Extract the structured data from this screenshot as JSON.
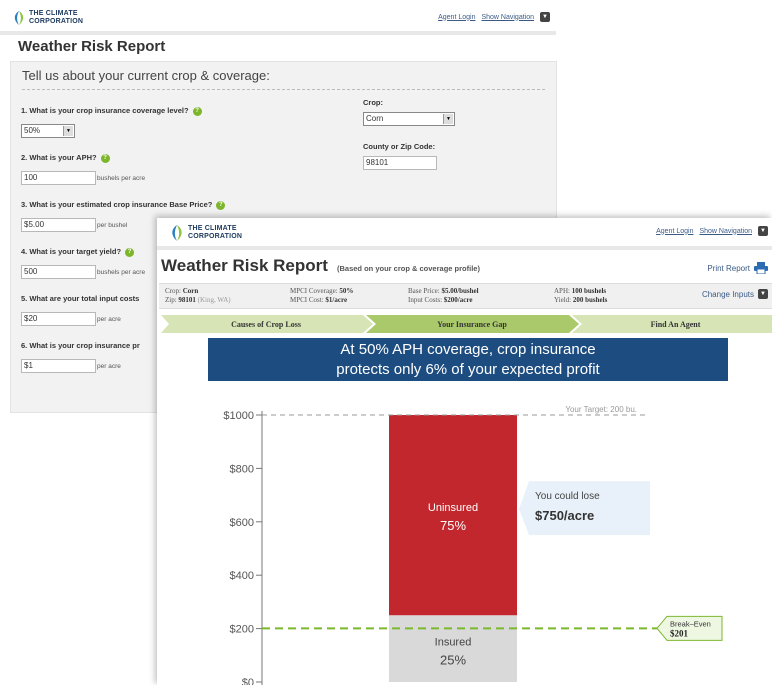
{
  "brand": {
    "line1": "THE CLIMATE",
    "line2": "CORPORATION"
  },
  "nav": {
    "agent_login": "Agent Login",
    "show_navigation": "Show Navigation"
  },
  "form": {
    "title": "Weather Risk Report",
    "panel_title": "Tell us about your current crop & coverage:",
    "questions": [
      {
        "label": "1. What is your crop insurance coverage level?",
        "value": "50%"
      },
      {
        "label": "2. What is your APH?",
        "value": "100",
        "unit": "bushels per acre"
      },
      {
        "label": "3. What is your estimated crop insurance Base Price?",
        "value": "$5.00",
        "unit": "per bushel"
      },
      {
        "label": "4. What is your target yield?",
        "value": "500",
        "unit": "bushels per acre"
      },
      {
        "label": "5. What are your total input costs",
        "value": "$20",
        "unit": "per acre"
      },
      {
        "label": "6. What is your crop insurance pr",
        "value": "$1",
        "unit": "per acre"
      }
    ],
    "crop_label": "Crop:",
    "crop_value": "Corn",
    "zip_label": "County or Zip Code:",
    "zip_value": "98101"
  },
  "report": {
    "title": "Weather Risk Report",
    "subtitle": "(Based on your crop & coverage profile)",
    "print_label": "Print Report",
    "summary": {
      "crop_label": "Crop:",
      "crop_value": "Corn",
      "zip_label": "Zip:",
      "zip_value": "98101",
      "zip_extra": "(King, WA)",
      "coverage_label": "MPCI Coverage:",
      "coverage_value": "50%",
      "cost_label": "MPCI Cost:",
      "cost_value": "$1/acre",
      "base_label": "Base Price:",
      "base_value": "$5.00/bushel",
      "input_label": "Input Costs:",
      "input_value": "$200/acre",
      "aph_label": "APH:",
      "aph_value": "100 bushels",
      "yield_label": "Yield:",
      "yield_value": "200 bushels"
    },
    "change_inputs": "Change Inputs",
    "steps": [
      "Causes of Crop Loss",
      "Your Insurance Gap",
      "Find An Agent"
    ],
    "banner_line1": "At 50% APH coverage, crop insurance",
    "banner_line2": "protects only 6% of your expected profit"
  },
  "chart_data": {
    "type": "bar",
    "ylim": [
      0,
      1000
    ],
    "yticks": [
      0,
      200,
      400,
      600,
      800,
      1000
    ],
    "ytick_labels": [
      "$0",
      "$200",
      "$400",
      "$600",
      "$800",
      "$1000"
    ],
    "segments": [
      {
        "name": "Insured",
        "label": "25%",
        "from": 0,
        "to": 250,
        "color": "#d9d9d9"
      },
      {
        "name": "Uninsured",
        "label": "75%",
        "from": 250,
        "to": 1000,
        "color": "#c1272d"
      }
    ],
    "target_label": "Your Target: 200 bu.",
    "target_value": 1000,
    "break_even_label": "Break–Even",
    "break_even_value_text": "$201",
    "break_even_value": 201,
    "callout_line1": "You could lose",
    "callout_line2": "$750/acre",
    "colors": {
      "breakeven": "#7cb82f",
      "callout_bg": "#e8f1f9",
      "axis": "#777777"
    }
  }
}
